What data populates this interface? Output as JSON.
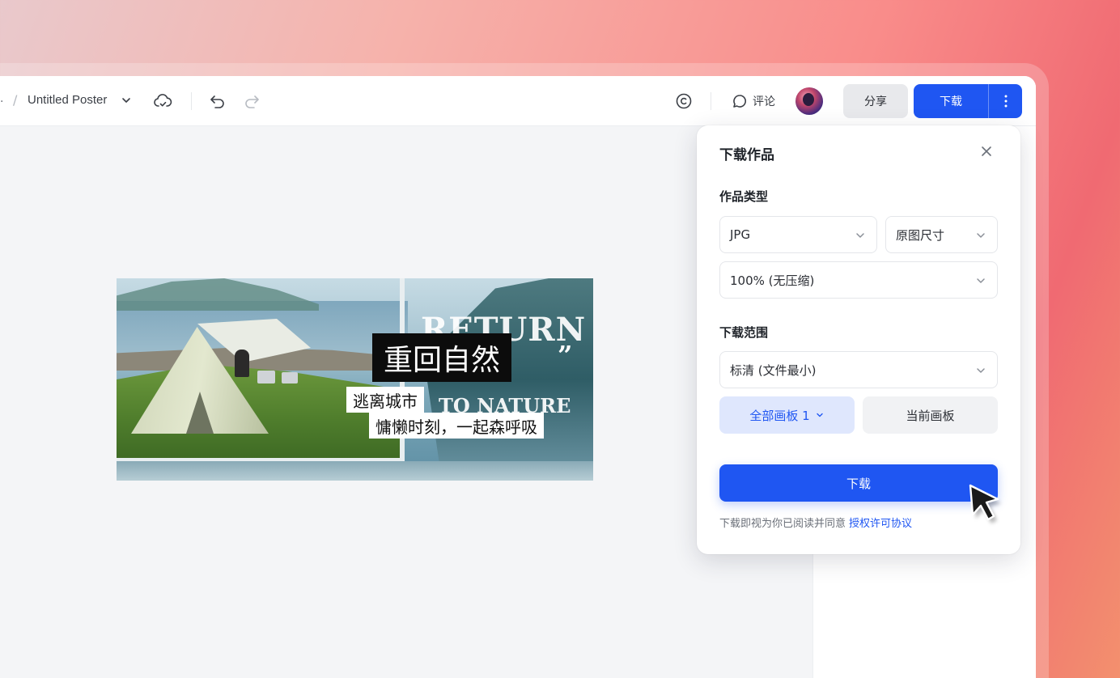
{
  "toolbar": {
    "crumb_prefix": ".",
    "crumb_separator": "/",
    "doc_title": "Untitled Poster",
    "comment_label": "评论",
    "share_label": "分享",
    "download_label": "下载"
  },
  "icons": {
    "cloud": "cloud-sync-icon",
    "undo": "undo-icon",
    "redo": "redo-icon",
    "copyright": "copyright-icon",
    "comment": "comment-icon",
    "more": "more-vertical-icon",
    "close": "close-icon",
    "chevron": "chevron-down-icon",
    "cursor": "mouse-cursor-icon"
  },
  "poster": {
    "title": "重回自然",
    "subtitle_1": "逃离城市",
    "subtitle_2": "慵懒时刻，一起森呼吸",
    "en_line_1": "RETURN",
    "en_quote": "”",
    "en_line_2": "TO NATURE"
  },
  "download_panel": {
    "title": "下载作品",
    "type_section_label": "作品类型",
    "format_value": "JPG",
    "size_value": "原图尺寸",
    "quality_value": "100% (无压缩)",
    "range_section_label": "下载范围",
    "resolution_value": "标清 (文件最小)",
    "all_pages_label": "全部画板 1",
    "current_page_label": "当前画板",
    "download_button_label": "下载",
    "terms_text": "下载即视为你已阅读并同意",
    "terms_link": "授权许可协议"
  },
  "colors": {
    "accent": "#1f56f2",
    "accent_soft": "#dfe7fd",
    "background_gradient_end": "#f06a72"
  }
}
